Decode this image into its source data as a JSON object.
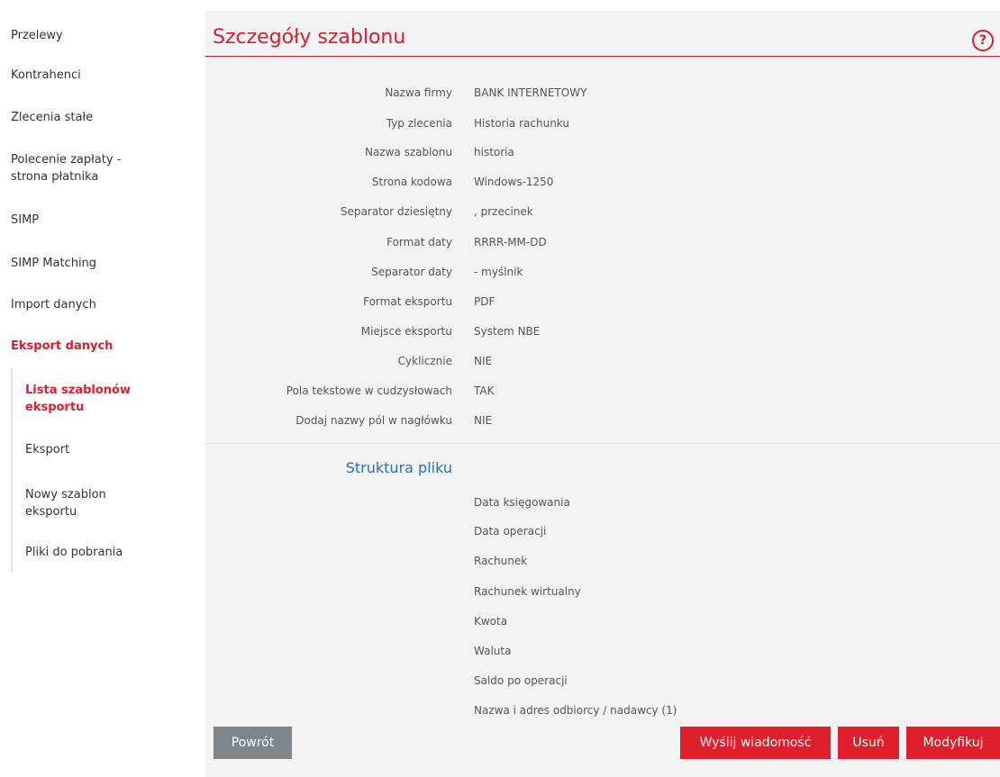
{
  "sidebar": {
    "items": [
      {
        "label": "Przelewy"
      },
      {
        "label": "Kontrahenci"
      },
      {
        "label": "Zlecenia stałe"
      },
      {
        "label": "Polecenie zapłaty - strona płatnika"
      },
      {
        "label": "SIMP"
      },
      {
        "label": "SIMP Matching"
      },
      {
        "label": "Import danych"
      },
      {
        "label": "Eksport danych"
      }
    ],
    "subitems": [
      {
        "label": "Lista szablonów eksportu"
      },
      {
        "label": "Eksport"
      },
      {
        "label": "Nowy szablon eksportu"
      },
      {
        "label": "Pliki do pobrania"
      }
    ]
  },
  "header": {
    "title": "Szczegóły szablonu",
    "help_icon": "?"
  },
  "details": [
    {
      "label": "Nazwa firmy",
      "value": "BANK INTERNETOWY"
    },
    {
      "label": "Typ zlecenia",
      "value": "Historia rachunku"
    },
    {
      "label": "Nazwa szablonu",
      "value": "historia"
    },
    {
      "label": "Strona kodowa",
      "value": "Windows-1250"
    },
    {
      "label": "Separator dziesiętny",
      "value": ", przecinek"
    },
    {
      "label": "Format daty",
      "value": "RRRR-MM-DD"
    },
    {
      "label": "Separator daty",
      "value": "- myślnik"
    },
    {
      "label": "Format eksportu",
      "value": "PDF"
    },
    {
      "label": "Miejsce eksportu",
      "value": "System NBE"
    },
    {
      "label": "Cyklicznie",
      "value": "NIE"
    },
    {
      "label": "Pola tekstowe w cudzysłowach",
      "value": "TAK"
    },
    {
      "label": "Dodaj nazwy pól w nagłówku",
      "value": "NIE"
    }
  ],
  "structure": {
    "title": "Struktura pliku",
    "items": [
      "Data księgowania",
      "Data operacji",
      "Rachunek",
      "Rachunek wirtualny",
      "Kwota",
      "Waluta",
      "Saldo po operacji",
      "Nazwa i adres odbiorcy / nadawcy (1)"
    ]
  },
  "buttons": {
    "back": "Powrót",
    "send": "Wyślij wiadomość",
    "delete": "Usuń",
    "modify": "Modyfikuj"
  },
  "colors": {
    "accent": "#d6202f",
    "link_blue": "#2a6eb8",
    "button_gray": "#7e868c"
  }
}
